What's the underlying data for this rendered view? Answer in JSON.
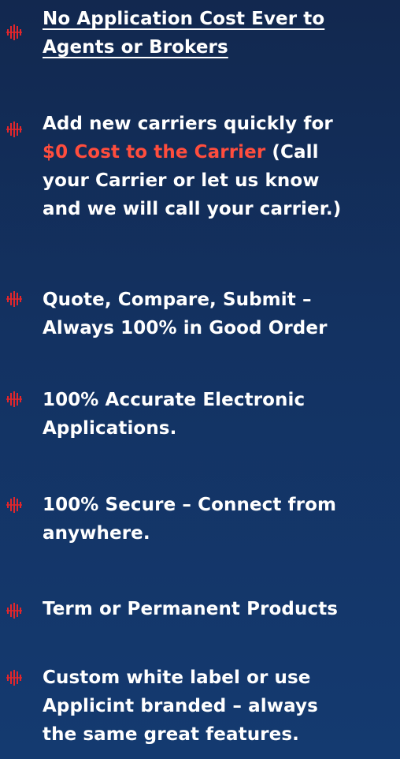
{
  "accent_color": "#e3262b",
  "highlight_color": "#ff4d3d",
  "bullet_icon": "vertical-bars-icon",
  "items": [
    {
      "lines": [
        "No Application Cost Ever to",
        "Agents or Brokers"
      ]
    },
    {
      "line1": "Add new carriers quickly for",
      "line2_highlight": "$0 Cost to the Carrier",
      "line2_rest": " (Call",
      "line3": "your Carrier or let us know",
      "line4": "and we will call your carrier.)"
    },
    {
      "lines": [
        "Quote, Compare, Submit –",
        "Always 100% in Good Order"
      ]
    },
    {
      "lines": [
        "100% Accurate Electronic",
        "Applications."
      ]
    },
    {
      "lines": [
        "100% Secure – Connect from",
        "anywhere."
      ]
    },
    {
      "lines": [
        "Term or Permanent Products"
      ]
    },
    {
      "lines": [
        "Custom white label or use",
        "Applicint branded – always",
        "the same great features."
      ]
    }
  ]
}
